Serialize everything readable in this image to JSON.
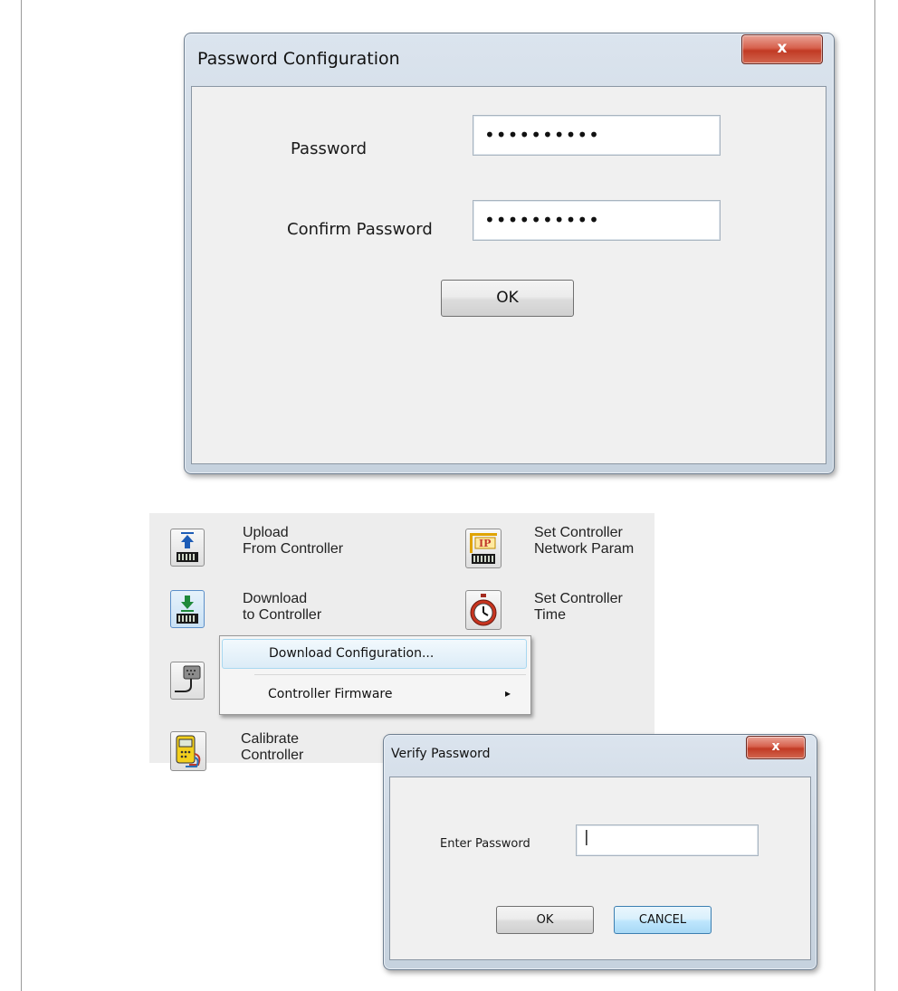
{
  "password_config": {
    "title": "Password Configuration",
    "close_glyph": "x",
    "password_label": "Password",
    "password_value": "••••••••••",
    "confirm_label": "Confirm Password",
    "confirm_value": "••••••••••",
    "ok_label": "OK"
  },
  "toolbar": {
    "upload_line1": "Upload",
    "upload_line2": "From Controller",
    "download_line1": "Download",
    "download_line2": "to Controller",
    "calibrate_line1": "Calibrate",
    "calibrate_line2": "Controller",
    "network_line1": "Set Controller",
    "network_line2": "Network Param",
    "network_icon_text": "IP",
    "time_line1": "Set Controller",
    "time_line2": "Time"
  },
  "context_menu": {
    "items": [
      {
        "label": "Download Configuration...",
        "submenu_glyph": ""
      },
      {
        "label": "Controller Firmware",
        "submenu_glyph": "▸"
      }
    ]
  },
  "verify_password": {
    "title": "Verify Password",
    "close_glyph": "x",
    "enter_label": "Enter Password",
    "enter_value": "|",
    "ok_label": "OK",
    "cancel_label": "CANCEL"
  },
  "icons": {
    "upload": "upload-from-controller-icon",
    "download": "download-to-controller-icon",
    "serial": "serial-cable-icon",
    "calibrate": "multimeter-icon",
    "network": "ip-network-icon",
    "time": "stopwatch-icon",
    "close": "close-icon",
    "submenu": "chevron-right-icon"
  },
  "colors": {
    "close_button": "#c94a33",
    "menu_highlight": "#dcecf7",
    "focus_button": "#bee6fd"
  }
}
